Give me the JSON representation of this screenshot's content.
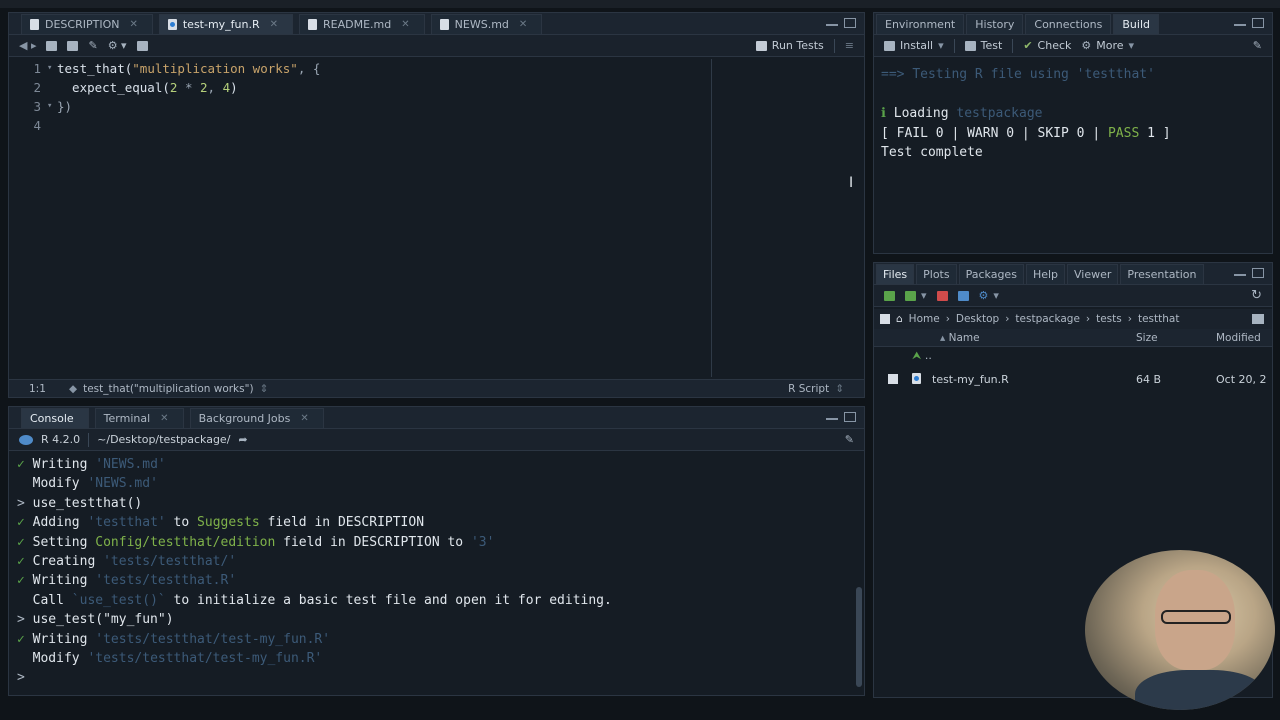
{
  "editor": {
    "tabs": [
      {
        "label": "DESCRIPTION",
        "active": false
      },
      {
        "label": "test-my_fun.R",
        "active": true
      },
      {
        "label": "README.md",
        "active": false
      },
      {
        "label": "NEWS.md",
        "active": false
      }
    ],
    "run_tests_label": "Run Tests",
    "lines": [
      {
        "n": "1",
        "fold": "▾",
        "parts": [
          [
            "fn",
            "test_that("
          ],
          [
            "str",
            "\"multiplication works\""
          ],
          [
            "punc",
            ", {"
          ]
        ]
      },
      {
        "n": "2",
        "fold": "",
        "parts": [
          [
            "fn",
            "  expect_equal("
          ],
          [
            "num",
            "2"
          ],
          [
            "punc",
            " * "
          ],
          [
            "num",
            "2"
          ],
          [
            "punc",
            ", "
          ],
          [
            "num",
            "4"
          ],
          [
            "fn",
            ")"
          ]
        ]
      },
      {
        "n": "3",
        "fold": "▾",
        "parts": [
          [
            "punc",
            "})"
          ]
        ]
      },
      {
        "n": "4",
        "fold": "",
        "parts": []
      }
    ],
    "status": {
      "position": "1:1",
      "context": "test_that(\"multiplication works\")",
      "language": "R Script"
    }
  },
  "console": {
    "tabs": [
      {
        "label": "Console",
        "active": true
      },
      {
        "label": "Terminal",
        "active": false
      },
      {
        "label": "Background Jobs",
        "active": false
      }
    ],
    "r_version": "R 4.2.0",
    "path": "~/Desktop/testpackage/",
    "lines": [
      [
        [
          "chk",
          "✓ "
        ],
        [
          "",
          "Writing "
        ],
        [
          "dim",
          "'NEWS.md'"
        ]
      ],
      [
        [
          "",
          "  Modify "
        ],
        [
          "dim",
          "'NEWS.md'"
        ]
      ],
      [
        [
          "prompt",
          "> "
        ],
        [
          "",
          "use_testthat()"
        ]
      ],
      [
        [
          "chk",
          "✓ "
        ],
        [
          "",
          "Adding "
        ],
        [
          "dim",
          "'testthat'"
        ],
        [
          "",
          " to "
        ],
        [
          "grn",
          "Suggests"
        ],
        [
          "",
          " field in DESCRIPTION"
        ]
      ],
      [
        [
          "chk",
          "✓ "
        ],
        [
          "",
          "Setting "
        ],
        [
          "grn",
          "Config/testthat/edition"
        ],
        [
          "",
          " field in DESCRIPTION to "
        ],
        [
          "dim",
          "'3'"
        ]
      ],
      [
        [
          "chk",
          "✓ "
        ],
        [
          "",
          "Creating "
        ],
        [
          "dim",
          "'tests/testthat/'"
        ]
      ],
      [
        [
          "chk",
          "✓ "
        ],
        [
          "",
          "Writing "
        ],
        [
          "dim",
          "'tests/testthat.R'"
        ]
      ],
      [
        [
          "",
          "  Call "
        ],
        [
          "dim",
          "`use_test()`"
        ],
        [
          "",
          " to initialize a basic test file and open it for editing."
        ]
      ],
      [
        [
          "prompt",
          "> "
        ],
        [
          "",
          "use_test(\"my_fun\")"
        ]
      ],
      [
        [
          "chk",
          "✓ "
        ],
        [
          "",
          "Writing "
        ],
        [
          "dim",
          "'tests/testthat/test-my_fun.R'"
        ]
      ],
      [
        [
          "",
          "  Modify "
        ],
        [
          "dim",
          "'tests/testthat/test-my_fun.R'"
        ]
      ],
      [
        [
          "prompt",
          "> "
        ],
        [
          "",
          ""
        ]
      ]
    ]
  },
  "build": {
    "tabs": [
      {
        "label": "Environment",
        "active": false
      },
      {
        "label": "History",
        "active": false
      },
      {
        "label": "Connections",
        "active": false
      },
      {
        "label": "Build",
        "active": true
      }
    ],
    "toolbar": {
      "install": "Install",
      "test": "Test",
      "check": "Check",
      "more": "More"
    },
    "output": [
      [
        [
          "dim",
          "==> "
        ],
        [
          "dim",
          "Testing R file using 'testthat'"
        ]
      ],
      [
        [
          "",
          ""
        ]
      ],
      [
        [
          "chk",
          "ℹ "
        ],
        [
          "",
          "Loading "
        ],
        [
          "dim",
          "testpackage"
        ]
      ],
      [
        [
          "",
          "[ FAIL 0 | WARN 0 | SKIP 0 | "
        ],
        [
          "pass",
          "PASS"
        ],
        [
          "",
          " 1 ]"
        ]
      ],
      [
        [
          "",
          "Test complete"
        ]
      ]
    ]
  },
  "files": {
    "tabs": [
      {
        "label": "Files",
        "active": true
      },
      {
        "label": "Plots",
        "active": false
      },
      {
        "label": "Packages",
        "active": false
      },
      {
        "label": "Help",
        "active": false
      },
      {
        "label": "Viewer",
        "active": false
      },
      {
        "label": "Presentation",
        "active": false
      }
    ],
    "breadcrumb": [
      "Home",
      "Desktop",
      "testpackage",
      "tests",
      "testthat"
    ],
    "columns": {
      "name": "Name",
      "size": "Size",
      "modified": "Modified"
    },
    "up_label": "..",
    "rows": [
      {
        "name": "test-my_fun.R",
        "size": "64 B",
        "modified": "Oct 20, 2"
      }
    ]
  }
}
